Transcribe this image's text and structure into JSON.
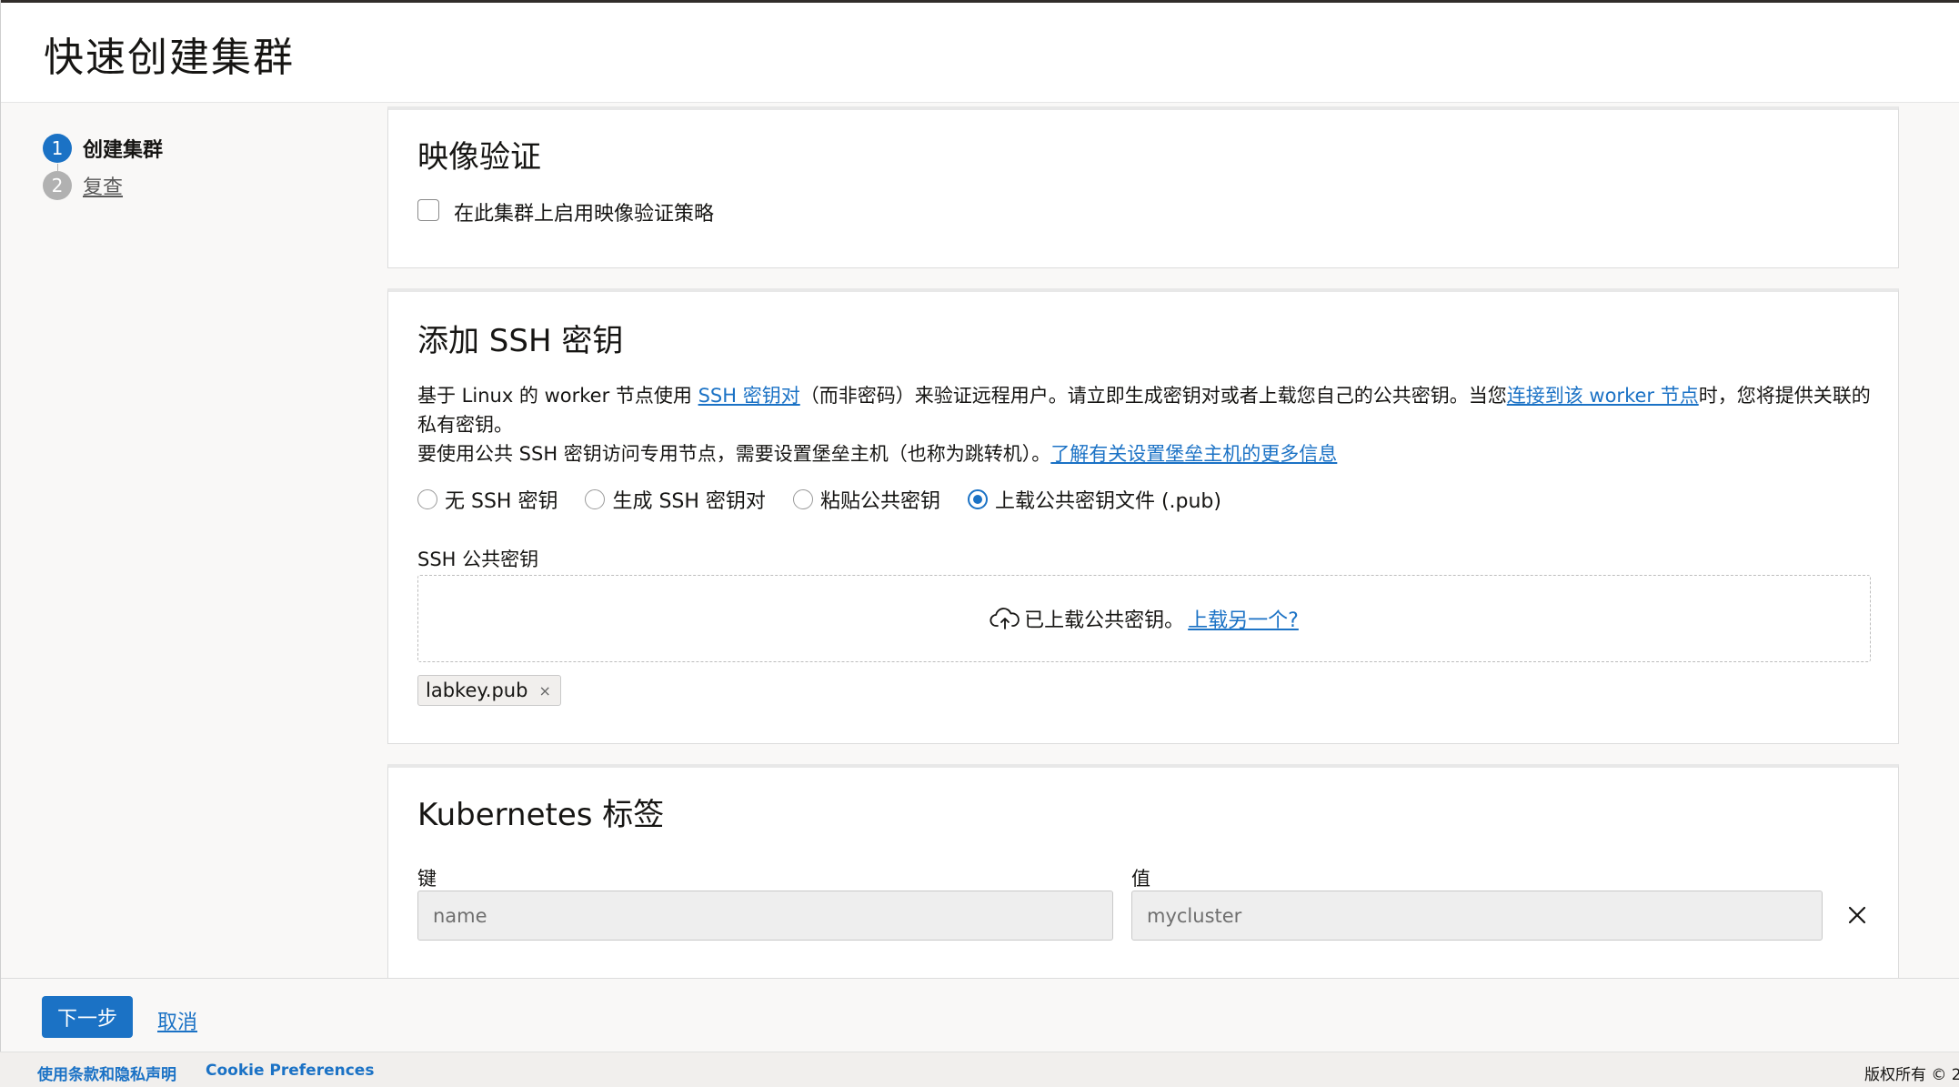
{
  "page": {
    "title": "快速创建集群"
  },
  "steps": [
    {
      "number": "1",
      "label": "创建集群",
      "state": "current"
    },
    {
      "number": "2",
      "label": "复查",
      "state": "pending"
    }
  ],
  "image_verification": {
    "title": "映像验证",
    "checkbox_label": "在此集群上启用映像验证策略",
    "checked": false
  },
  "ssh": {
    "title": "添加 SSH 密钥",
    "desc_part1": "基于 Linux 的 worker 节点使用 ",
    "desc_link1": "SSH 密钥对",
    "desc_part2": "（而非密码）来验证远程用户。请立即生成密钥对或者上载您自己的公共密钥。当您",
    "desc_link2": "连接到该 worker 节点",
    "desc_part3": "时，您将提供关联的私有密钥。",
    "desc_line2": "要使用公共 SSH 密钥访问专用节点，需要设置堡垒主机（也称为跳转机）。",
    "desc_link3": "了解有关设置堡垒主机的更多信息",
    "options": [
      {
        "label": "无 SSH 密钥",
        "checked": false
      },
      {
        "label": "生成 SSH 密钥对",
        "checked": false
      },
      {
        "label": "粘贴公共密钥",
        "checked": false
      },
      {
        "label": "上载公共密钥文件 (.pub)",
        "checked": true
      }
    ],
    "public_key_label": "SSH 公共密钥",
    "upload_status": "已上载公共密钥。",
    "upload_another": "上载另一个?",
    "file_chip": "labkey.pub",
    "chip_remove": "×"
  },
  "k8s_labels": {
    "title": "Kubernetes 标签",
    "key_label": "键",
    "value_label": "值",
    "key_value": "name",
    "value_value": "mycluster"
  },
  "actions": {
    "next": "下一步",
    "cancel": "取消"
  },
  "footer": {
    "terms": "使用条款和隐私声明",
    "cookie": "Cookie Preferences",
    "copyright": "版权所有 © 2"
  },
  "colors": {
    "accent": "#1b72c5",
    "background": "#f9f8f7"
  },
  "icons": [
    "upload-cloud-icon",
    "close-icon",
    "chip-remove-icon"
  ]
}
